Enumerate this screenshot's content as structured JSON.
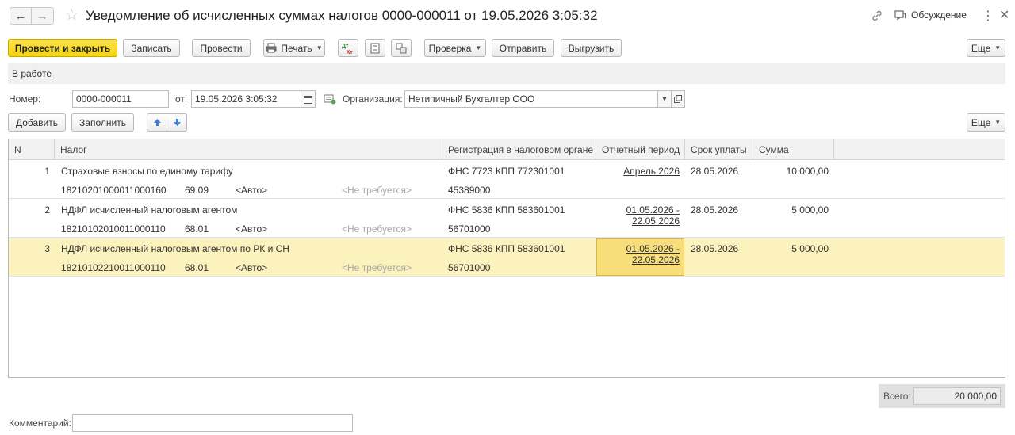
{
  "window": {
    "title": "Уведомление об исчисленных суммах налогов 0000-000011 от 19.05.2026 3:05:32",
    "discussion_label": "Обсуждение"
  },
  "toolbar": {
    "post_and_close": "Провести и закрыть",
    "save": "Записать",
    "post": "Провести",
    "print": "Печать",
    "check": "Проверка",
    "send": "Отправить",
    "export": "Выгрузить",
    "more": "Еще"
  },
  "status": {
    "label": "В работе"
  },
  "header": {
    "number_label": "Номер:",
    "number_value": "0000-000011",
    "date_label": "от:",
    "date_value": "19.05.2026  3:05:32",
    "org_label": "Организация:",
    "org_value": "Нетипичный Бухгалтер ООО"
  },
  "table_toolbar": {
    "add": "Добавить",
    "fill": "Заполнить",
    "more": "Еще"
  },
  "table": {
    "columns": [
      "N",
      "Налог",
      "Регистрация в налоговом органе",
      "Отчетный период",
      "Срок уплаты",
      "Сумма"
    ],
    "rows": [
      {
        "n": "1",
        "tax": "Страховые взносы по единому тарифу",
        "kbk": "18210201000011000160",
        "account": "69.09",
        "auto": "<Авто>",
        "not_required": "<Не требуется>",
        "registration": "ФНС 7723 КПП 772301001",
        "oktmo": "45389000",
        "period_line1": "Апрель 2026",
        "period_line2": "",
        "due": "28.05.2026",
        "sum": "10 000,00"
      },
      {
        "n": "2",
        "tax": "НДФЛ исчисленный налоговым агентом",
        "kbk": "18210102010011000110",
        "account": "68.01",
        "auto": "<Авто>",
        "not_required": "<Не требуется>",
        "registration": "ФНС 5836 КПП 583601001",
        "oktmo": "56701000",
        "period_line1": "01.05.2026 -",
        "period_line2": "22.05.2026",
        "due": "28.05.2026",
        "sum": "5 000,00"
      },
      {
        "n": "3",
        "tax": "НДФЛ исчисленный налоговым агентом по РК и СН",
        "kbk": "18210102210011000110",
        "account": "68.01",
        "auto": "<Авто>",
        "not_required": "<Не требуется>",
        "registration": "ФНС 5836 КПП 583601001",
        "oktmo": "56701000",
        "period_line1": "01.05.2026 -",
        "period_line2": "22.05.2026",
        "due": "28.05.2026",
        "sum": "5 000,00"
      }
    ]
  },
  "footer": {
    "total_label": "Всего:",
    "total_value": "20 000,00",
    "comment_label": "Комментарий:",
    "comment_value": ""
  },
  "colors": {
    "primary_button": "#f5d30f",
    "selected_row": "#fcf2bd",
    "current_cell": "#f7de7a"
  }
}
